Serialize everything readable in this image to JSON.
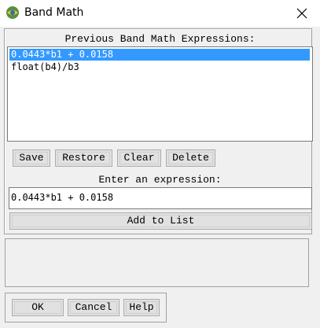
{
  "window": {
    "title": "Band Math",
    "app_icon": "envi-globe-icon",
    "close_icon": "close-icon"
  },
  "previous": {
    "label": "Previous Band Math Expressions:",
    "items": [
      {
        "text": "0.0443*b1 + 0.0158",
        "selected": true
      },
      {
        "text": "float(b4)/b3",
        "selected": false
      }
    ]
  },
  "list_buttons": {
    "save": "Save",
    "restore": "Restore",
    "clear": "Clear",
    "delete": "Delete"
  },
  "expression": {
    "label": "Enter an expression:",
    "value": "0.0443*b1 + 0.0158"
  },
  "add_to_list": "Add to List",
  "dialog_buttons": {
    "ok": "OK",
    "cancel": "Cancel",
    "help": "Help"
  },
  "colors": {
    "selection": "#3399ff",
    "window_bg": "#f0f0f0"
  }
}
